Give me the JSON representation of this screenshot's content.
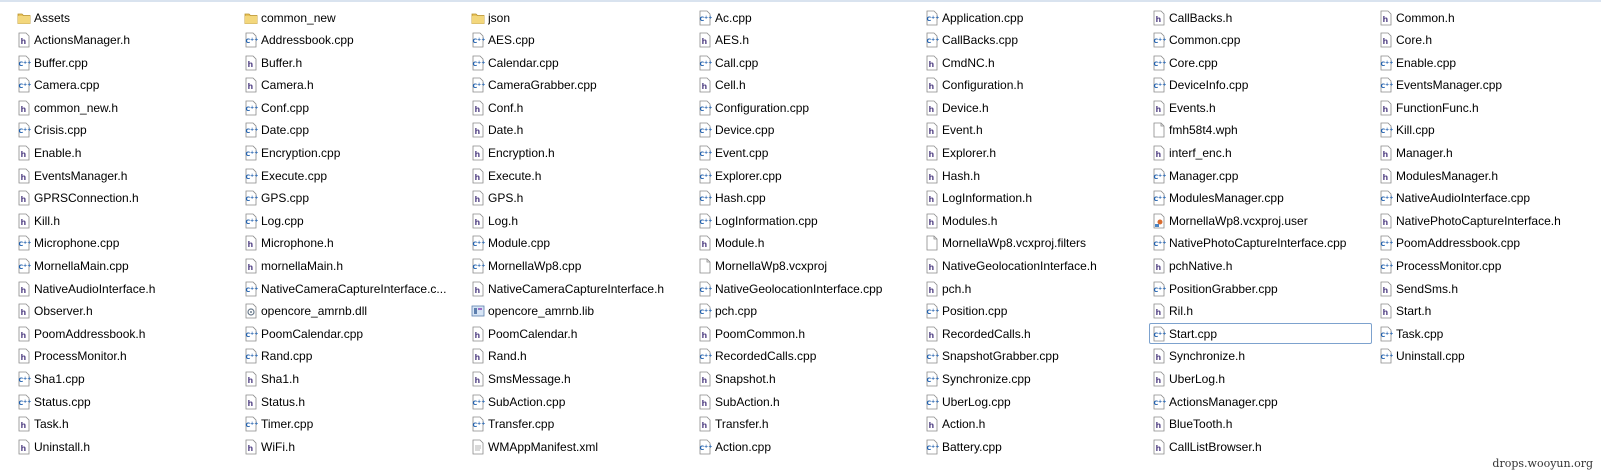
{
  "watermark": "drops.wooyun.org",
  "accent_selection": "#7da2ce",
  "files": [
    {
      "name": "Assets",
      "icon": "folder-icon"
    },
    {
      "name": "ActionsManager.h",
      "icon": "h-file-icon"
    },
    {
      "name": "Buffer.cpp",
      "icon": "cpp-file-icon"
    },
    {
      "name": "Camera.cpp",
      "icon": "cpp-file-icon"
    },
    {
      "name": "common_new.h",
      "icon": "h-file-icon"
    },
    {
      "name": "Crisis.cpp",
      "icon": "cpp-file-icon"
    },
    {
      "name": "Enable.h",
      "icon": "h-file-icon"
    },
    {
      "name": "EventsManager.h",
      "icon": "h-file-icon"
    },
    {
      "name": "GPRSConnection.h",
      "icon": "h-file-icon"
    },
    {
      "name": "Kill.h",
      "icon": "h-file-icon"
    },
    {
      "name": "Microphone.cpp",
      "icon": "cpp-file-icon"
    },
    {
      "name": "MornellaMain.cpp",
      "icon": "cpp-file-icon"
    },
    {
      "name": "NativeAudioInterface.h",
      "icon": "h-file-icon"
    },
    {
      "name": "Observer.h",
      "icon": "h-file-icon"
    },
    {
      "name": "PoomAddressbook.h",
      "icon": "h-file-icon"
    },
    {
      "name": "ProcessMonitor.h",
      "icon": "h-file-icon"
    },
    {
      "name": "Sha1.cpp",
      "icon": "cpp-file-icon"
    },
    {
      "name": "Status.cpp",
      "icon": "cpp-file-icon"
    },
    {
      "name": "Task.h",
      "icon": "h-file-icon"
    },
    {
      "name": "Uninstall.h",
      "icon": "h-file-icon"
    },
    {
      "name": "common_new",
      "icon": "folder-icon"
    },
    {
      "name": "Addressbook.cpp",
      "icon": "cpp-file-icon"
    },
    {
      "name": "Buffer.h",
      "icon": "h-file-icon"
    },
    {
      "name": "Camera.h",
      "icon": "h-file-icon"
    },
    {
      "name": "Conf.cpp",
      "icon": "cpp-file-icon"
    },
    {
      "name": "Date.cpp",
      "icon": "cpp-file-icon"
    },
    {
      "name": "Encryption.cpp",
      "icon": "cpp-file-icon"
    },
    {
      "name": "Execute.cpp",
      "icon": "cpp-file-icon"
    },
    {
      "name": "GPS.cpp",
      "icon": "cpp-file-icon"
    },
    {
      "name": "Log.cpp",
      "icon": "cpp-file-icon"
    },
    {
      "name": "Microphone.h",
      "icon": "h-file-icon"
    },
    {
      "name": "mornellaMain.h",
      "icon": "h-file-icon"
    },
    {
      "name": "NativeCameraCaptureInterface.c...",
      "icon": "cpp-file-icon"
    },
    {
      "name": "opencore_amrnb.dll",
      "icon": "dll-file-icon"
    },
    {
      "name": "PoomCalendar.cpp",
      "icon": "cpp-file-icon"
    },
    {
      "name": "Rand.cpp",
      "icon": "cpp-file-icon"
    },
    {
      "name": "Sha1.h",
      "icon": "h-file-icon"
    },
    {
      "name": "Status.h",
      "icon": "h-file-icon"
    },
    {
      "name": "Timer.cpp",
      "icon": "cpp-file-icon"
    },
    {
      "name": "WiFi.h",
      "icon": "h-file-icon"
    },
    {
      "name": "json",
      "icon": "folder-icon"
    },
    {
      "name": "AES.cpp",
      "icon": "cpp-file-icon"
    },
    {
      "name": "Calendar.cpp",
      "icon": "cpp-file-icon"
    },
    {
      "name": "CameraGrabber.cpp",
      "icon": "cpp-file-icon"
    },
    {
      "name": "Conf.h",
      "icon": "h-file-icon"
    },
    {
      "name": "Date.h",
      "icon": "h-file-icon"
    },
    {
      "name": "Encryption.h",
      "icon": "h-file-icon"
    },
    {
      "name": "Execute.h",
      "icon": "h-file-icon"
    },
    {
      "name": "GPS.h",
      "icon": "h-file-icon"
    },
    {
      "name": "Log.h",
      "icon": "h-file-icon"
    },
    {
      "name": "Module.cpp",
      "icon": "cpp-file-icon"
    },
    {
      "name": "MornellaWp8.cpp",
      "icon": "cpp-file-icon"
    },
    {
      "name": "NativeCameraCaptureInterface.h",
      "icon": "h-file-icon"
    },
    {
      "name": "opencore_amrnb.lib",
      "icon": "lib-file-icon"
    },
    {
      "name": "PoomCalendar.h",
      "icon": "h-file-icon"
    },
    {
      "name": "Rand.h",
      "icon": "h-file-icon"
    },
    {
      "name": "SmsMessage.h",
      "icon": "h-file-icon"
    },
    {
      "name": "SubAction.cpp",
      "icon": "cpp-file-icon"
    },
    {
      "name": "Transfer.cpp",
      "icon": "cpp-file-icon"
    },
    {
      "name": "WMAppManifest.xml",
      "icon": "xml-file-icon"
    },
    {
      "name": "Ac.cpp",
      "icon": "cpp-file-icon"
    },
    {
      "name": "AES.h",
      "icon": "h-file-icon"
    },
    {
      "name": "Call.cpp",
      "icon": "cpp-file-icon"
    },
    {
      "name": "Cell.h",
      "icon": "h-file-icon"
    },
    {
      "name": "Configuration.cpp",
      "icon": "cpp-file-icon"
    },
    {
      "name": "Device.cpp",
      "icon": "cpp-file-icon"
    },
    {
      "name": "Event.cpp",
      "icon": "cpp-file-icon"
    },
    {
      "name": "Explorer.cpp",
      "icon": "cpp-file-icon"
    },
    {
      "name": "Hash.cpp",
      "icon": "cpp-file-icon"
    },
    {
      "name": "LogInformation.cpp",
      "icon": "cpp-file-icon"
    },
    {
      "name": "Module.h",
      "icon": "h-file-icon"
    },
    {
      "name": "MornellaWp8.vcxproj",
      "icon": "generic-file-icon"
    },
    {
      "name": "NativeGeolocationInterface.cpp",
      "icon": "cpp-file-icon"
    },
    {
      "name": "pch.cpp",
      "icon": "cpp-file-icon"
    },
    {
      "name": "PoomCommon.h",
      "icon": "h-file-icon"
    },
    {
      "name": "RecordedCalls.cpp",
      "icon": "cpp-file-icon"
    },
    {
      "name": "Snapshot.h",
      "icon": "h-file-icon"
    },
    {
      "name": "SubAction.h",
      "icon": "h-file-icon"
    },
    {
      "name": "Transfer.h",
      "icon": "h-file-icon"
    },
    {
      "name": "Action.cpp",
      "icon": "cpp-file-icon"
    },
    {
      "name": "Application.cpp",
      "icon": "cpp-file-icon"
    },
    {
      "name": "CallBacks.cpp",
      "icon": "cpp-file-icon"
    },
    {
      "name": "CmdNC.h",
      "icon": "h-file-icon"
    },
    {
      "name": "Configuration.h",
      "icon": "h-file-icon"
    },
    {
      "name": "Device.h",
      "icon": "h-file-icon"
    },
    {
      "name": "Event.h",
      "icon": "h-file-icon"
    },
    {
      "name": "Explorer.h",
      "icon": "h-file-icon"
    },
    {
      "name": "Hash.h",
      "icon": "h-file-icon"
    },
    {
      "name": "LogInformation.h",
      "icon": "h-file-icon"
    },
    {
      "name": "Modules.h",
      "icon": "h-file-icon"
    },
    {
      "name": "MornellaWp8.vcxproj.filters",
      "icon": "generic-file-icon"
    },
    {
      "name": "NativeGeolocationInterface.h",
      "icon": "h-file-icon"
    },
    {
      "name": "pch.h",
      "icon": "h-file-icon"
    },
    {
      "name": "Position.cpp",
      "icon": "cpp-file-icon"
    },
    {
      "name": "RecordedCalls.h",
      "icon": "h-file-icon"
    },
    {
      "name": "SnapshotGrabber.cpp",
      "icon": "cpp-file-icon"
    },
    {
      "name": "Synchronize.cpp",
      "icon": "cpp-file-icon"
    },
    {
      "name": "UberLog.cpp",
      "icon": "cpp-file-icon"
    },
    {
      "name": "Action.h",
      "icon": "h-file-icon"
    },
    {
      "name": "Battery.cpp",
      "icon": "cpp-file-icon"
    },
    {
      "name": "CallBacks.h",
      "icon": "h-file-icon"
    },
    {
      "name": "Common.cpp",
      "icon": "cpp-file-icon"
    },
    {
      "name": "Core.cpp",
      "icon": "cpp-file-icon"
    },
    {
      "name": "DeviceInfo.cpp",
      "icon": "cpp-file-icon"
    },
    {
      "name": "Events.h",
      "icon": "h-file-icon"
    },
    {
      "name": "fmh58t4.wph",
      "icon": "generic-file-icon"
    },
    {
      "name": "interf_enc.h",
      "icon": "h-file-icon"
    },
    {
      "name": "Manager.cpp",
      "icon": "cpp-file-icon"
    },
    {
      "name": "ModulesManager.cpp",
      "icon": "cpp-file-icon"
    },
    {
      "name": "MornellaWp8.vcxproj.user",
      "icon": "user-file-icon"
    },
    {
      "name": "NativePhotoCaptureInterface.cpp",
      "icon": "cpp-file-icon"
    },
    {
      "name": "pchNative.h",
      "icon": "h-file-icon"
    },
    {
      "name": "PositionGrabber.cpp",
      "icon": "cpp-file-icon"
    },
    {
      "name": "Ril.h",
      "icon": "h-file-icon"
    },
    {
      "name": "Start.cpp",
      "icon": "cpp-file-icon",
      "selected": true
    },
    {
      "name": "Synchronize.h",
      "icon": "h-file-icon"
    },
    {
      "name": "UberLog.h",
      "icon": "h-file-icon"
    },
    {
      "name": "ActionsManager.cpp",
      "icon": "cpp-file-icon"
    },
    {
      "name": "BlueTooth.h",
      "icon": "h-file-icon"
    },
    {
      "name": "CallListBrowser.h",
      "icon": "h-file-icon"
    },
    {
      "name": "Common.h",
      "icon": "h-file-icon"
    },
    {
      "name": "Core.h",
      "icon": "h-file-icon"
    },
    {
      "name": "Enable.cpp",
      "icon": "cpp-file-icon"
    },
    {
      "name": "EventsManager.cpp",
      "icon": "cpp-file-icon"
    },
    {
      "name": "FunctionFunc.h",
      "icon": "h-file-icon"
    },
    {
      "name": "Kill.cpp",
      "icon": "cpp-file-icon"
    },
    {
      "name": "Manager.h",
      "icon": "h-file-icon"
    },
    {
      "name": "ModulesManager.h",
      "icon": "h-file-icon"
    },
    {
      "name": "NativeAudioInterface.cpp",
      "icon": "cpp-file-icon"
    },
    {
      "name": "NativePhotoCaptureInterface.h",
      "icon": "h-file-icon"
    },
    {
      "name": "PoomAddressbook.cpp",
      "icon": "cpp-file-icon"
    },
    {
      "name": "ProcessMonitor.cpp",
      "icon": "cpp-file-icon"
    },
    {
      "name": "SendSms.h",
      "icon": "h-file-icon"
    },
    {
      "name": "Start.h",
      "icon": "h-file-icon"
    },
    {
      "name": "Task.cpp",
      "icon": "cpp-file-icon"
    },
    {
      "name": "Uninstall.cpp",
      "icon": "cpp-file-icon"
    }
  ]
}
